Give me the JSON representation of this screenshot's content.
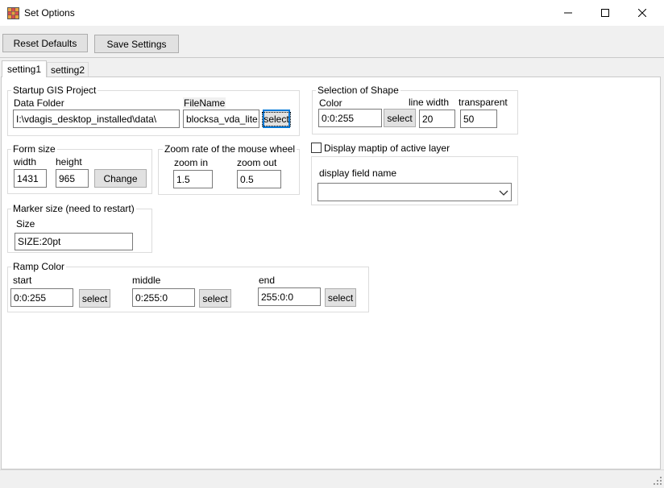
{
  "window": {
    "title": "Set Options"
  },
  "toolbar": {
    "reset_label": "Reset Defaults",
    "save_label": "Save Settings"
  },
  "tabs": [
    {
      "label": "setting1"
    },
    {
      "label": "setting2"
    }
  ],
  "startup": {
    "legend": "Startup GIS Project",
    "data_folder_label": "Data Folder",
    "data_folder_value": "I:\\vdagis_desktop_installed\\data\\",
    "filename_label": "FileName",
    "filename_value": "blocksa_vda_lite.",
    "select_label": "select"
  },
  "shape": {
    "legend": "Selection of Shape",
    "color_label": "Color",
    "color_value": "0:0:255",
    "select_label": "select",
    "line_width_label": "line width",
    "line_width_value": "20",
    "transparent_label": "transparent",
    "transparent_value": "50"
  },
  "form_size": {
    "legend": "Form size",
    "width_label": "width",
    "width_value": "1431",
    "height_label": "height",
    "height_value": "965",
    "change_label": "Change"
  },
  "zoom": {
    "legend": "Zoom rate of the mouse wheel",
    "in_label": "zoom in",
    "in_value": "1.5",
    "out_label": "zoom out",
    "out_value": "0.5"
  },
  "maptip": {
    "checkbox_label": "Display maptip of active layer",
    "checked": false,
    "field_label": "display field name",
    "field_value": ""
  },
  "marker": {
    "legend": "Marker size (need to restart)",
    "size_label": "Size",
    "size_value": "SIZE:20pt"
  },
  "ramp": {
    "legend": "Ramp Color",
    "start_label": "start",
    "start_value": "0:0:255",
    "middle_label": "middle",
    "middle_value": "0:255:0",
    "end_label": "end",
    "end_value": "255:0:0",
    "select_label": "select"
  },
  "colors": {
    "accent": "#0078d7",
    "panel": "#ffffff",
    "window": "#f0f0f0"
  }
}
